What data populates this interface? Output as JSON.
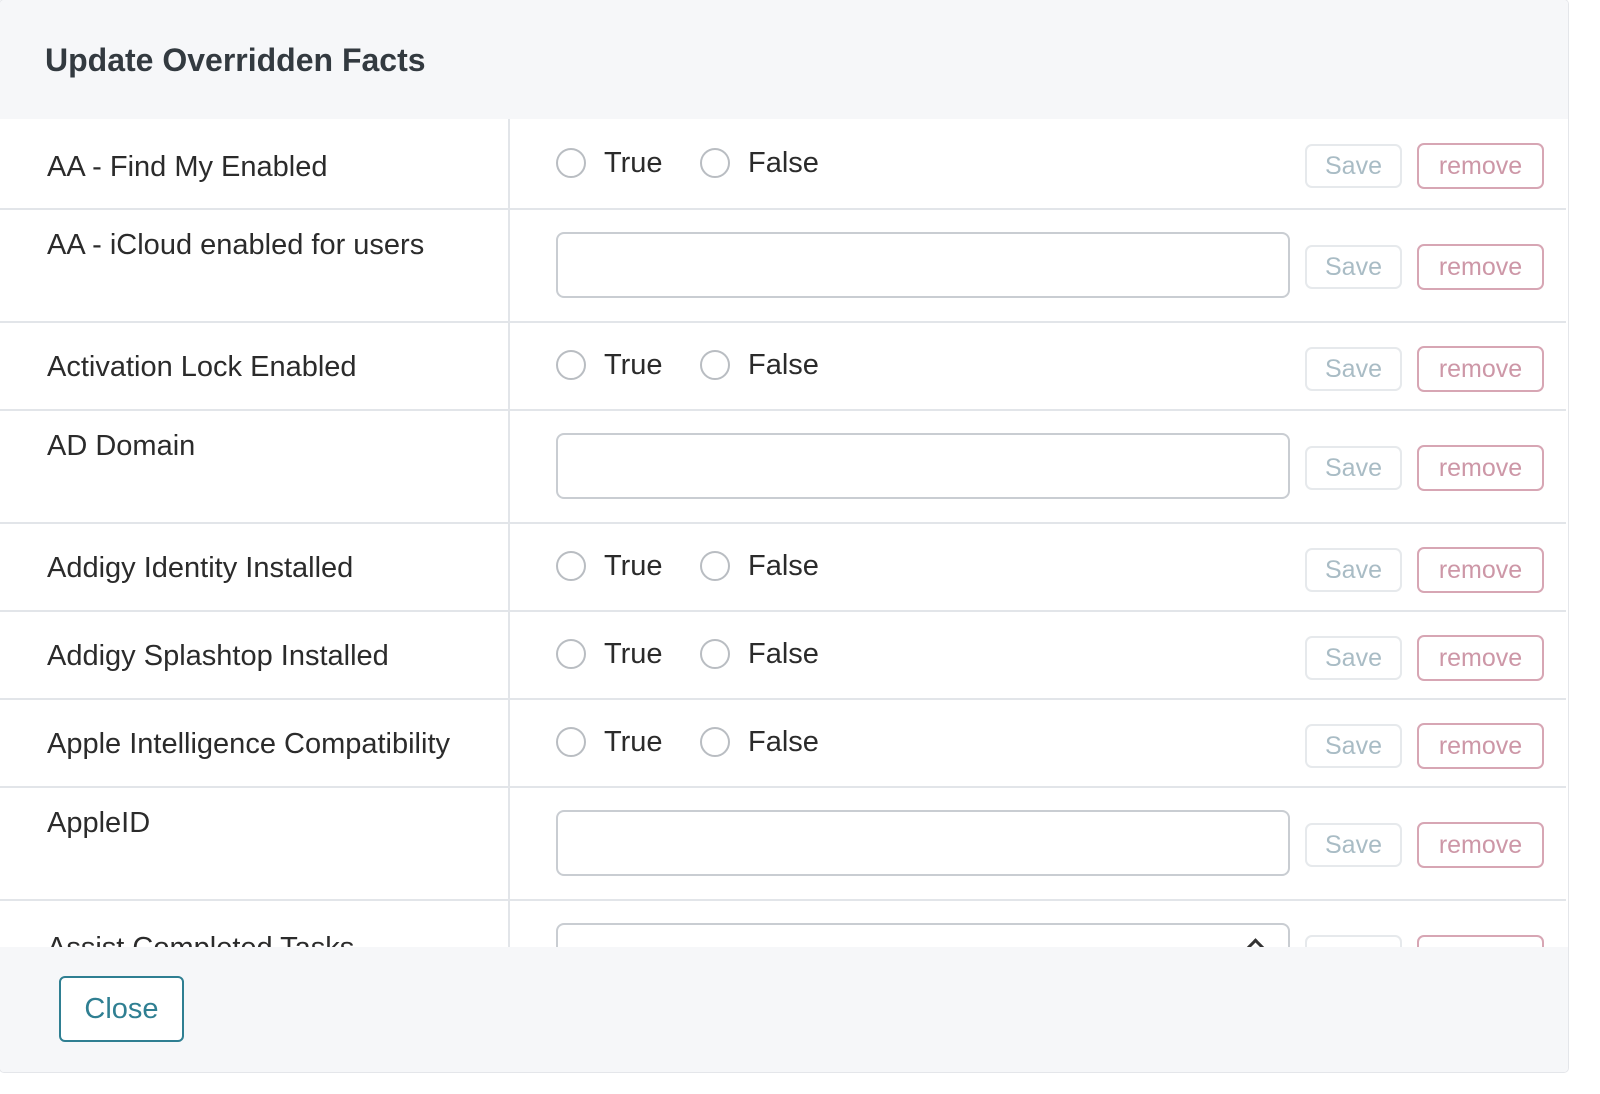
{
  "modal": {
    "title": "Update Overridden Facts",
    "close_label": "Close"
  },
  "labels": {
    "save": "Save",
    "remove": "remove",
    "true": "True",
    "false": "False"
  },
  "facts": [
    {
      "name": "AA - Find My Enabled",
      "type": "boolean",
      "value": null
    },
    {
      "name": "AA - iCloud enabled for users",
      "type": "text",
      "value": ""
    },
    {
      "name": "Activation Lock Enabled",
      "type": "boolean",
      "value": null
    },
    {
      "name": "AD Domain",
      "type": "text",
      "value": ""
    },
    {
      "name": "Addigy Identity Installed",
      "type": "boolean",
      "value": null
    },
    {
      "name": "Addigy Splashtop Installed",
      "type": "boolean",
      "value": null
    },
    {
      "name": "Apple Intelligence Compatibility",
      "type": "boolean",
      "value": null
    },
    {
      "name": "AppleID",
      "type": "text",
      "value": ""
    },
    {
      "name": "Assist Completed Tasks",
      "type": "select",
      "value": ""
    }
  ],
  "colors": {
    "header_bg": "#f6f7f9",
    "close_accent": "#2f7f92",
    "remove_accent": "#d7a6b4",
    "save_text": "#a9bcc5"
  }
}
